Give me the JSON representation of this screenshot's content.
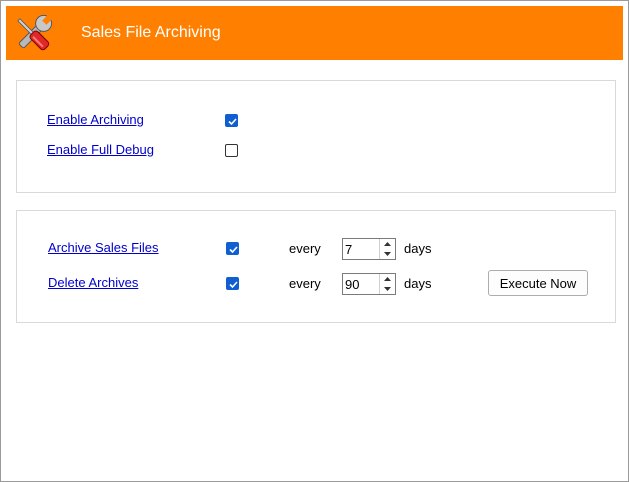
{
  "header": {
    "title": "Sales File Archiving",
    "icon": "tools-icon",
    "background_color": "#ff8000"
  },
  "general": {
    "enable_archiving": {
      "label": "Enable Archiving",
      "checked": true
    },
    "enable_full_debug": {
      "label": "Enable Full Debug",
      "checked": false
    }
  },
  "schedule": {
    "archive_sales_files": {
      "label": "Archive Sales Files",
      "checked": true,
      "every_label": "every",
      "value": "7",
      "unit_label": "days"
    },
    "delete_archives": {
      "label": "Delete Archives",
      "checked": true,
      "every_label": "every",
      "value": "90",
      "unit_label": "days"
    },
    "execute_button_label": "Execute Now"
  },
  "colors": {
    "accent": "#0f5fd0",
    "link": "#0000cc"
  }
}
